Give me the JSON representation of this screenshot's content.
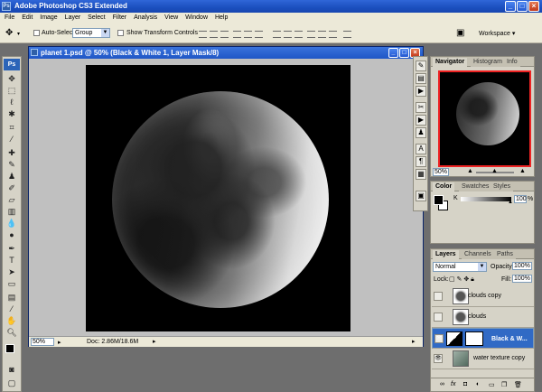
{
  "app": {
    "title": "Adobe Photoshop CS3 Extended",
    "logo": "Ps",
    "window_buttons": [
      "_",
      "□",
      "×"
    ]
  },
  "menu": [
    "File",
    "Edit",
    "Image",
    "Layer",
    "Select",
    "Filter",
    "Analysis",
    "View",
    "Window",
    "Help"
  ],
  "options": {
    "auto_select_label": "Auto-Select:",
    "auto_select_value": "Group",
    "show_transform_label": "Show Transform Controls",
    "workspace_label": "Workspace ▾"
  },
  "document": {
    "title": "planet 1.psd @ 50% (Black & White 1, Layer Mask/8)",
    "zoom": "50%",
    "doc_info": "Doc: 2.86M/18.6M"
  },
  "navigator": {
    "tabs": [
      "Navigator",
      "Histogram",
      "Info"
    ],
    "zoom": "50%"
  },
  "color": {
    "tabs": [
      "Color",
      "Swatches",
      "Styles"
    ],
    "channel": "K",
    "value": "100",
    "unit": "%",
    "foreground_color": "#000000",
    "background_color": "#ffffff"
  },
  "layers": {
    "tabs": [
      "Layers",
      "Channels",
      "Paths"
    ],
    "blend_mode": "Normal",
    "opacity_label": "Opacity:",
    "opacity": "100%",
    "lock_label": "Lock:",
    "fill_label": "Fill:",
    "fill": "100%",
    "items": [
      {
        "name": "clouds copy"
      },
      {
        "name": "clouds"
      },
      {
        "name": "Black & W..."
      },
      {
        "name": "water texture copy"
      }
    ],
    "bottom_icons": [
      "link-icon",
      "fx-icon",
      "mask-icon",
      "adjustment-icon",
      "folder-icon",
      "new-layer-icon",
      "trash-icon"
    ]
  },
  "colors": {
    "title_blue": "#2459d1",
    "selection_blue": "#316ac5",
    "panel_gray": "#d6d3c7",
    "workspace_gray": "#6e6e6e"
  }
}
